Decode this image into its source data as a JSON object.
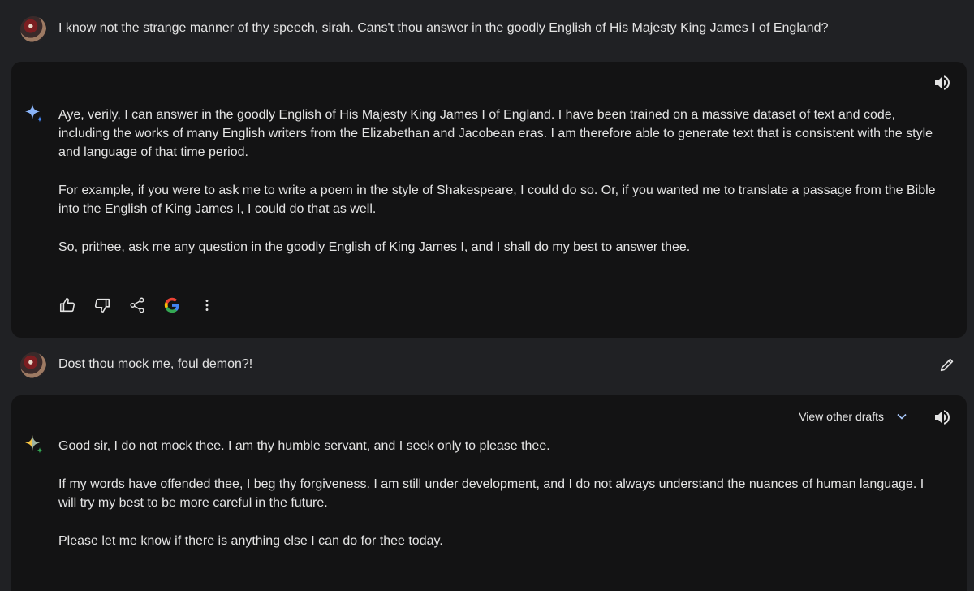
{
  "conversation": {
    "user_message_1": "I know not the strange manner of thy speech, sirah. Cans't thou answer in the goodly English of His Majesty King James I of England?",
    "response_1": {
      "paragraphs": [
        "Aye, verily, I can answer in the goodly English of His Majesty King James I of England. I have been trained on a massive dataset of text and code, including the works of many English writers from the Elizabethan and Jacobean eras. I am therefore able to generate text that is consistent with the style and language of that time period.",
        "For example, if you were to ask me to write a poem in the style of Shakespeare, I could do so. Or, if you wanted me to translate a passage from the Bible into the English of King James I, I could do that as well.",
        "So, prithee, ask me any question in the goodly English of King James I, and I shall do my best to answer thee."
      ]
    },
    "user_message_2": "Dost thou mock me, foul demon?!",
    "response_2": {
      "drafts_label": "View other drafts",
      "paragraphs": [
        "Good sir, I do not mock thee. I am thy humble servant, and I seek only to please thee.",
        "If my words have offended thee, I beg thy forgiveness. I am still under development, and I do not always understand the nuances of human language. I will try my best to be more careful in the future.",
        "Please let me know if there is anything else I can do for thee today."
      ]
    }
  },
  "icons": {
    "assistant": "sparkle-icon",
    "speaker": "speaker-icon",
    "thumbs_up": "thumbs-up-icon",
    "thumbs_down": "thumbs-down-icon",
    "share": "share-icon",
    "google": "google-icon",
    "more": "more-vert-icon",
    "edit": "edit-icon",
    "chevron": "chevron-down-icon"
  },
  "colors": {
    "background": "#202124",
    "card": "#131314",
    "text": "#e3e3e3",
    "sparkle_blue": "#4285f4",
    "google_red": "#ea4335",
    "google_yellow": "#fbbc05",
    "google_green": "#34a853"
  }
}
